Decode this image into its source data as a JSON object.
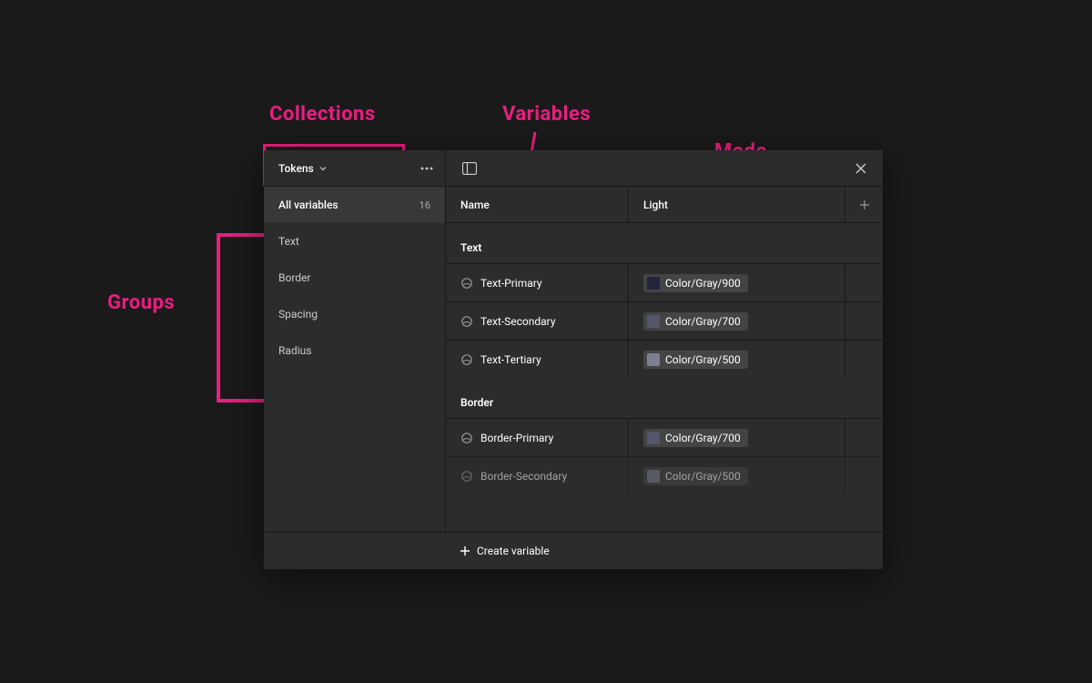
{
  "annotations": {
    "collections": "Collections",
    "variables": "Variables",
    "mode": "Mode",
    "groups": "Groups"
  },
  "sidebar": {
    "collection_label": "Tokens",
    "all_label": "All variables",
    "all_count": "16",
    "groups": [
      {
        "label": "Text"
      },
      {
        "label": "Border"
      },
      {
        "label": "Spacing"
      },
      {
        "label": "Radius"
      }
    ]
  },
  "columns": {
    "name": "Name",
    "mode": "Light"
  },
  "groups": [
    {
      "name": "Text",
      "vars": [
        {
          "name": "Text-Primary",
          "value_label": "Color/Gray/900",
          "swatch": "#23233a"
        },
        {
          "name": "Text-Secondary",
          "value_label": "Color/Gray/700",
          "swatch": "#55556b"
        },
        {
          "name": "Text-Tertiary",
          "value_label": "Color/Gray/500",
          "swatch": "#7e7e92"
        }
      ]
    },
    {
      "name": "Border",
      "vars": [
        {
          "name": "Border-Primary",
          "value_label": "Color/Gray/700",
          "swatch": "#55556b"
        },
        {
          "name": "Border-Secondary",
          "value_label": "Color/Gray/500",
          "swatch": "#7e7e92"
        }
      ]
    }
  ],
  "footer": {
    "create_label": "Create variable"
  },
  "colors": {
    "accent": "#e91e80"
  }
}
